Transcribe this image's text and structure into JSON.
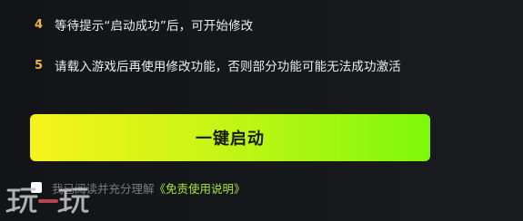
{
  "steps": [
    {
      "num": "4",
      "text": "等待提示“启动成功”后，可开始修改"
    },
    {
      "num": "5",
      "text": "请载入游戏后再使用修改功能，否则部分功能可能无法成功激活"
    }
  ],
  "launch_button": {
    "label": "一键启动",
    "gradient_start": "#f7f21c",
    "gradient_end": "#7ef80a"
  },
  "agreement": {
    "checked": false,
    "text": "我已阅读并充分理解",
    "link_label": "《免责使用说明》"
  },
  "watermark": {
    "text": "玩一玩"
  },
  "colors": {
    "background": "#16181c",
    "step_number": "#e8b93a",
    "link": "#a6e63a"
  }
}
